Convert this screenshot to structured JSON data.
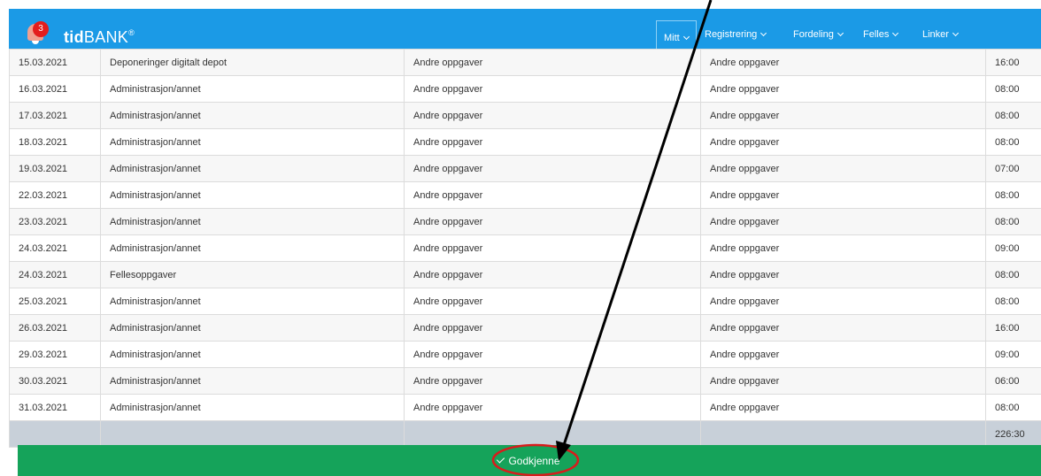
{
  "header": {
    "notification_count": "3",
    "logo_bold": "tid",
    "logo_rest": "BANK",
    "logo_mark": "®",
    "nav": [
      {
        "label": "Mitt"
      },
      {
        "label": "Registrering"
      },
      {
        "label": "Fordeling"
      },
      {
        "label": "Felles"
      },
      {
        "label": "Linker"
      }
    ]
  },
  "rows": [
    {
      "date": "15.03.2021",
      "activity": "Deponeringer digitalt depot",
      "cat1": "Andre oppgaver",
      "cat2": "Andre oppgaver",
      "hours": "16:00"
    },
    {
      "date": "16.03.2021",
      "activity": "Administrasjon/annet",
      "cat1": "Andre oppgaver",
      "cat2": "Andre oppgaver",
      "hours": "08:00"
    },
    {
      "date": "17.03.2021",
      "activity": "Administrasjon/annet",
      "cat1": "Andre oppgaver",
      "cat2": "Andre oppgaver",
      "hours": "08:00"
    },
    {
      "date": "18.03.2021",
      "activity": "Administrasjon/annet",
      "cat1": "Andre oppgaver",
      "cat2": "Andre oppgaver",
      "hours": "08:00"
    },
    {
      "date": "19.03.2021",
      "activity": "Administrasjon/annet",
      "cat1": "Andre oppgaver",
      "cat2": "Andre oppgaver",
      "hours": "07:00"
    },
    {
      "date": "22.03.2021",
      "activity": "Administrasjon/annet",
      "cat1": "Andre oppgaver",
      "cat2": "Andre oppgaver",
      "hours": "08:00"
    },
    {
      "date": "23.03.2021",
      "activity": "Administrasjon/annet",
      "cat1": "Andre oppgaver",
      "cat2": "Andre oppgaver",
      "hours": "08:00"
    },
    {
      "date": "24.03.2021",
      "activity": "Administrasjon/annet",
      "cat1": "Andre oppgaver",
      "cat2": "Andre oppgaver",
      "hours": "09:00"
    },
    {
      "date": "24.03.2021",
      "activity": "Fellesoppgaver",
      "cat1": "Andre oppgaver",
      "cat2": "Andre oppgaver",
      "hours": "08:00"
    },
    {
      "date": "25.03.2021",
      "activity": "Administrasjon/annet",
      "cat1": "Andre oppgaver",
      "cat2": "Andre oppgaver",
      "hours": "08:00"
    },
    {
      "date": "26.03.2021",
      "activity": "Administrasjon/annet",
      "cat1": "Andre oppgaver",
      "cat2": "Andre oppgaver",
      "hours": "16:00"
    },
    {
      "date": "29.03.2021",
      "activity": "Administrasjon/annet",
      "cat1": "Andre oppgaver",
      "cat2": "Andre oppgaver",
      "hours": "09:00"
    },
    {
      "date": "30.03.2021",
      "activity": "Administrasjon/annet",
      "cat1": "Andre oppgaver",
      "cat2": "Andre oppgaver",
      "hours": "06:00"
    },
    {
      "date": "31.03.2021",
      "activity": "Administrasjon/annet",
      "cat1": "Andre oppgaver",
      "cat2": "Andre oppgaver",
      "hours": "08:00"
    }
  ],
  "total": "226:30",
  "approve_label": "Godkjenne",
  "colors": {
    "navbar": "#1b9ae6",
    "approve": "#15a35a",
    "annotation_red": "#d81c1c"
  }
}
